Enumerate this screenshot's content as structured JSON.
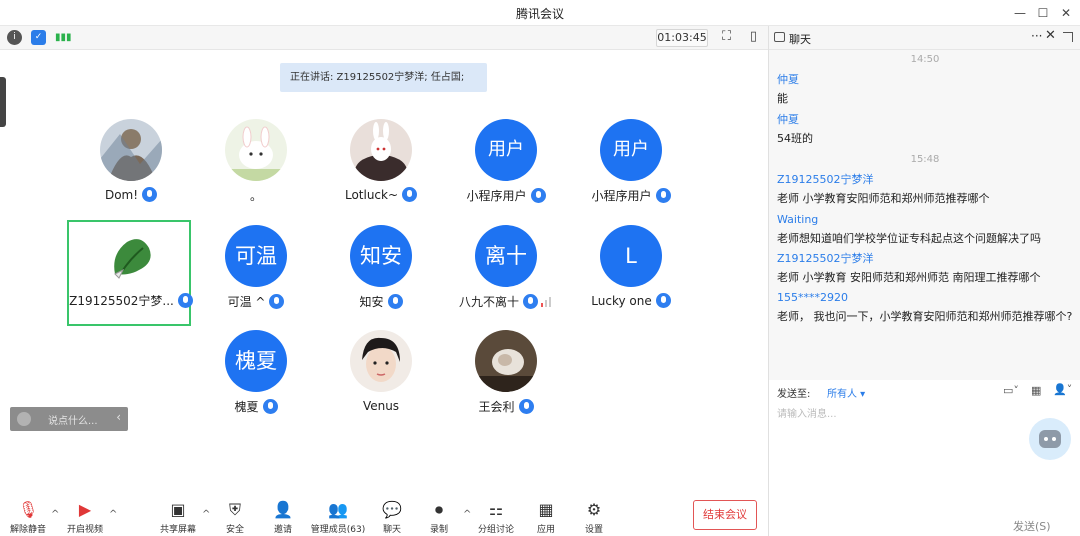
{
  "window": {
    "title": "腾讯会议"
  },
  "toolbar": {
    "timer": "01:03:45"
  },
  "speaking": {
    "text": "正在讲话: Z19125502宁梦洋; 任占国;"
  },
  "participants": [
    {
      "name": "Dom!",
      "avatar": "",
      "mic": "on"
    },
    {
      "name": "。",
      "avatar": "",
      "mic": "none"
    },
    {
      "name": "Lotluck~",
      "avatar": "",
      "mic": "on"
    },
    {
      "name": "小程序用户",
      "avatar": "用户",
      "mic": "on"
    },
    {
      "name": "小程序用户",
      "avatar": "用户",
      "mic": "on"
    },
    {
      "name": "Z19125502宁梦...",
      "avatar": "",
      "mic": "on"
    },
    {
      "name": "可温 ^",
      "avatar": "可温",
      "mic": "on"
    },
    {
      "name": "知安",
      "avatar": "知安",
      "mic": "on"
    },
    {
      "name": "八九不离十",
      "avatar": "离十",
      "mic": "on"
    },
    {
      "name": "Lucky one",
      "avatar": "L",
      "mic": "on"
    },
    {
      "name": "槐夏",
      "avatar": "槐夏",
      "mic": "on"
    },
    {
      "name": "Venus",
      "avatar": "",
      "mic": "none"
    },
    {
      "name": "王会利",
      "avatar": "",
      "mic": "on"
    }
  ],
  "saybox": {
    "placeholder": "说点什么..."
  },
  "bottom": {
    "unmute": "解除静音",
    "video": "开启视频",
    "share": "共享屏幕",
    "security": "安全",
    "invite": "邀请",
    "members": "管理成员(63)",
    "chat": "聊天",
    "record": "录制",
    "breakout": "分组讨论",
    "apps": "应用",
    "settings": "设置",
    "end": "结束会议"
  },
  "chat": {
    "title": "聊天",
    "messages": [
      {
        "type": "time",
        "text": "14:50"
      },
      {
        "type": "msg",
        "who": "仲夏",
        "text": "能"
      },
      {
        "type": "msg",
        "who": "仲夏",
        "text": "54班的"
      },
      {
        "type": "time",
        "text": "15:48"
      },
      {
        "type": "msg",
        "who": "Z19125502宁梦洋",
        "text": "老师 小学教育安阳师范和郑州师范推荐哪个"
      },
      {
        "type": "msg",
        "who": "Waiting",
        "text": "老师想知道咱们学校学位证专科起点这个问题解决了吗"
      },
      {
        "type": "msg",
        "who": "Z19125502宁梦洋",
        "text": "老师 小学教育 安阳师范和郑州师范 南阳理工推荐哪个"
      },
      {
        "type": "msg",
        "who": "155****2920",
        "text": "老师，  我也问一下，小学教育安阳师范和郑州师范推荐哪个?"
      }
    ],
    "send_to_label": "发送至:",
    "send_to_value": "所有人 ▾",
    "input_placeholder": "请输入消息...",
    "send": "发送(S)"
  }
}
